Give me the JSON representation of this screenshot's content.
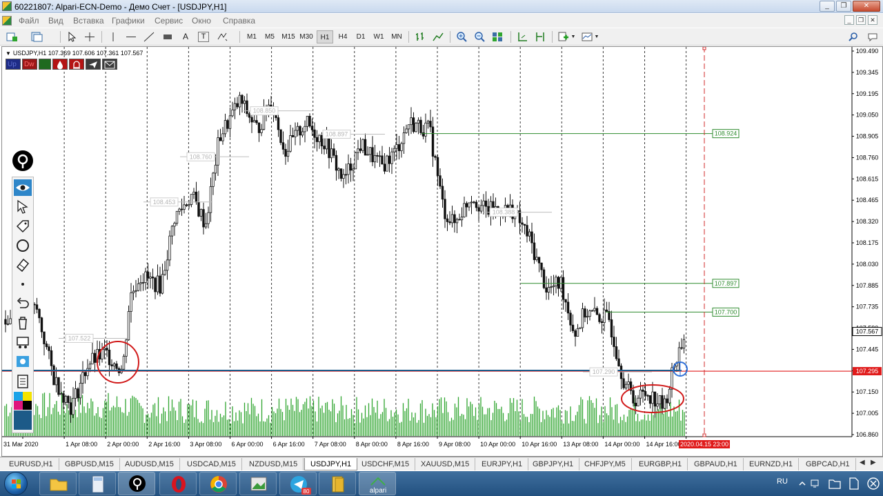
{
  "window": {
    "title": "60221807: Alpari-ECN-Demo - Демо Счет - [USDJPY,H1]",
    "controls": [
      "_",
      "❐",
      "✕"
    ]
  },
  "menu": {
    "items": [
      "Файл",
      "Вид",
      "Вставка",
      "Графики",
      "Сервис",
      "Окно",
      "Справка"
    ],
    "mdi_controls": [
      "_",
      "❐",
      "✕"
    ]
  },
  "toolbar": {
    "timeframes": [
      "M1",
      "M5",
      "M15",
      "M30",
      "H1",
      "H4",
      "D1",
      "W1",
      "MN"
    ],
    "active_timeframe": "H1",
    "text_tool": "A",
    "text_label_tool": "T"
  },
  "chart": {
    "header": "USDJPY,H1  107.369 107.606 107.361 107.567",
    "indicator_buttons": {
      "up": "Up",
      "dw": "Dw"
    },
    "timestamp_label": "2020.04.15 23:00"
  },
  "chart_data": {
    "type": "candlestick",
    "symbol": "USDJPY",
    "timeframe": "H1",
    "ohlc_last": {
      "open": 107.369,
      "high": 107.606,
      "low": 107.361,
      "close": 107.567
    },
    "y_ticks": [
      "109.490",
      "109.345",
      "109.195",
      "109.050",
      "108.905",
      "108.760",
      "108.615",
      "108.465",
      "108.320",
      "108.175",
      "108.030",
      "107.885",
      "107.735",
      "107.590",
      "107.445",
      "107.295",
      "107.150",
      "107.005",
      "106.860"
    ],
    "x_ticks": [
      "31 Mar 2020",
      "1 Apr 08:00",
      "2 Apr 00:00",
      "2 Apr 16:00",
      "3 Apr 08:00",
      "6 Apr 00:00",
      "6 Apr 16:00",
      "7 Apr 08:00",
      "8 Apr 00:00",
      "8 Apr 16:00",
      "9 Apr 08:00",
      "10 Apr 00:00",
      "10 Apr 16:00",
      "13 Apr 08:00",
      "14 Apr 00:00",
      "14 Apr 16:00",
      "15 A"
    ],
    "ylim": [
      106.86,
      109.49
    ],
    "levels": [
      {
        "price": 108.924,
        "label": "108.924",
        "color": "#2e8b2e"
      },
      {
        "price": 107.897,
        "label": "107.897",
        "color": "#2e8b2e"
      },
      {
        "price": 107.7,
        "label": "107.700",
        "color": "#2e8b2e"
      },
      {
        "price": 107.295,
        "label": "107.295",
        "color": "#e01b1b"
      }
    ],
    "faded_labels": [
      "108.760",
      "108.453",
      "108.897",
      "108.850",
      "107.522",
      "108.388",
      "107.290"
    ],
    "current_price": "107.567",
    "colors": {
      "bull": "#1f1f1f",
      "bear": "#1f1f1f",
      "volume": "#2fa52f",
      "grid": "#c7c7c7",
      "support": "#1c5a88",
      "bid_line": "#e01b1b",
      "period_line": "#d02a2a",
      "circles": "#d11919",
      "blue_circle": "#2e6fd8"
    },
    "legend": "none"
  },
  "tabs": {
    "items": [
      "EURUSD,H1",
      "GBPUSD,M15",
      "AUDUSD,M15",
      "USDCAD,M15",
      "NZDUSD,M15",
      "USDJPY,H1",
      "USDCHF,M15",
      "XAUUSD,M15",
      "EURJPY,H1",
      "GBPJPY,H1",
      "CHFJPY,M5",
      "EURGBP,H1",
      "GBPAUD,H1",
      "EURNZD,H1",
      "GBPCAD,H1"
    ],
    "active": "USDJPY,H1",
    "nav_prev": "◀",
    "nav_next": "▶"
  },
  "taskbar": {
    "language": "RU",
    "alpari_label": "alpari",
    "telegram_badge": "80"
  }
}
